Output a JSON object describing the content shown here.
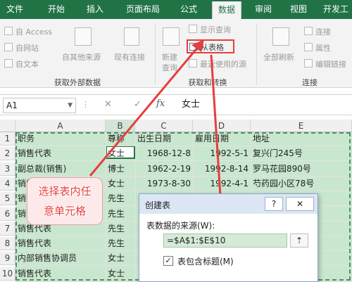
{
  "tabs": [
    "文件",
    "开始",
    "插入",
    "页面布局",
    "公式",
    "数据",
    "审阅",
    "视图",
    "开发工"
  ],
  "active_tab": "数据",
  "ribbon": {
    "get_external": {
      "from_access": "自 Access",
      "from_web": "自网站",
      "from_text": "自文本",
      "from_other": "自其他来源",
      "existing": "现有连接",
      "group_label": "获取外部数据"
    },
    "get_transform": {
      "new_query": "新建",
      "new_query_line2": "查询",
      "show_queries": "显示查询",
      "from_table": "从表格",
      "recent_sources": "最近使用的源",
      "group_label": "获取和转换"
    },
    "connections": {
      "refresh_all": "全部刷新",
      "connections": "连接",
      "properties": "属性",
      "edit_links": "编辑链接",
      "group_label": "连接"
    }
  },
  "formula_bar": {
    "name_box": "A1",
    "fx": "fx",
    "value": "女士"
  },
  "columns": [
    "A",
    "B",
    "C",
    "D",
    "E"
  ],
  "rows": [
    [
      "职务",
      "尊称",
      "出生日期",
      "雇用日期",
      "地址"
    ],
    [
      "销售代表",
      "女士",
      "1968-12-8",
      "1992-5-1",
      "复兴门245号"
    ],
    [
      "副总裁(销售)",
      "博士",
      "1962-2-19",
      "1992-8-14",
      "罗马花园890号"
    ],
    [
      "销售代表",
      "女士",
      "1973-8-30",
      "1992-4-1",
      "芍药园小区78号"
    ],
    [
      "销售代表",
      "先生",
      "",
      "",
      "号"
    ],
    [
      "销售代表",
      "先生",
      "",
      "",
      "号"
    ],
    [
      "销售代表",
      "先生",
      "",
      "",
      "0号"
    ],
    [
      "销售代表",
      "先生",
      "",
      "",
      ""
    ],
    [
      "内部销售协调员",
      "女士",
      "",
      "",
      ""
    ],
    [
      "销售代表",
      "女士",
      "",
      "",
      ""
    ]
  ],
  "row_numbers": [
    "1",
    "2",
    "3",
    "4",
    "5",
    "6",
    "7",
    "8",
    "9",
    "10"
  ],
  "callout": {
    "line1": "选择表内任",
    "line2": "意单元格"
  },
  "dialog": {
    "title": "创建表",
    "help": "?",
    "close": "✕",
    "source_label": "表数据的来源(W):",
    "range_value": "=$A$1:$E$10",
    "has_headers_label": "表包含标题(M)",
    "has_headers_checked": true
  },
  "colors": {
    "excel_green": "#217346",
    "highlight_red": "#e53e3e",
    "selection_green": "#c9e7cf"
  }
}
